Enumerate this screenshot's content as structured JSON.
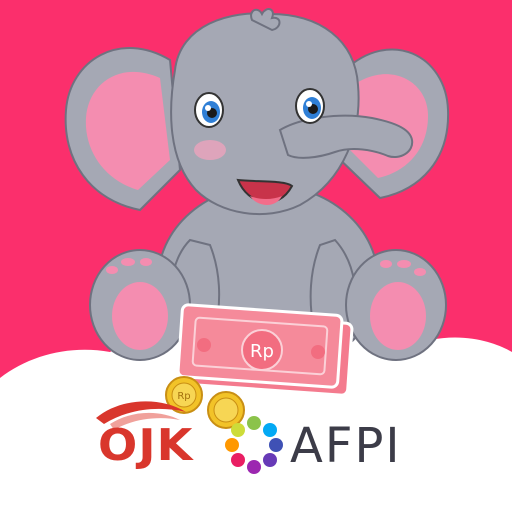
{
  "banner": {
    "currency_label": "Rp",
    "coin_label": "Rp",
    "logos": {
      "ojk": "OJK",
      "afpi": "AFPI"
    }
  },
  "colors": {
    "background": "#fb2f6c",
    "elephant_body": "#a5a8b4",
    "ear_inner": "#f48db0",
    "banknote": "#f47b8e",
    "coin": "#f2c328",
    "cloud": "#ffffff",
    "ojk_red": "#d9362c",
    "afpi_text": "#3c3c48"
  }
}
